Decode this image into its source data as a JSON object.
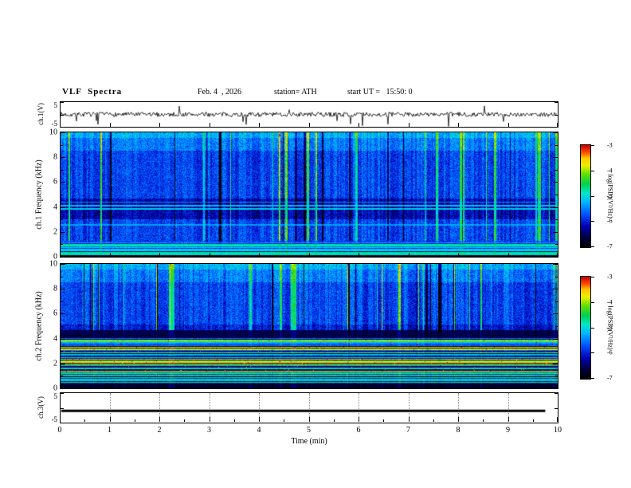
{
  "header": {
    "title": "VLF  Spectra",
    "date": "Feb. 4  , 2026",
    "station": "station= ATH",
    "start_ut": "start UT =   15:50: 0"
  },
  "axes": {
    "x_label": "Time (min)",
    "x_ticks": [
      "0",
      "1",
      "2",
      "3",
      "4",
      "5",
      "6",
      "7",
      "8",
      "9",
      "10"
    ],
    "x_range": [
      0,
      10
    ],
    "freq_ticks": [
      10,
      8,
      6,
      4,
      2,
      0
    ],
    "wave_ticks": [
      5,
      -5
    ]
  },
  "colorbar": {
    "label": "log(PSD)(V²/Hz)",
    "ticks": [
      -3,
      -4,
      -5,
      -6,
      -7
    ],
    "stops": [
      [
        0.0,
        "#000000"
      ],
      [
        0.08,
        "#000035"
      ],
      [
        0.2,
        "#0000b0"
      ],
      [
        0.32,
        "#0050ff"
      ],
      [
        0.44,
        "#00b4ff"
      ],
      [
        0.53,
        "#00e6c8"
      ],
      [
        0.62,
        "#00d050"
      ],
      [
        0.72,
        "#66e000"
      ],
      [
        0.8,
        "#eaf000"
      ],
      [
        0.875,
        "#ffc800"
      ],
      [
        0.93,
        "#ff5000"
      ],
      [
        1.0,
        "#cc0000"
      ]
    ]
  },
  "chart_data": [
    {
      "type": "line",
      "panel": "ch1-waveform",
      "ylabel": "ch.1(V)",
      "x_range": [
        0,
        10
      ],
      "y_range": [
        -5,
        5
      ],
      "seed": 7,
      "signal": {
        "baseline": 0,
        "noise_amp": 0.9,
        "neg_spike_prob": 0.025,
        "pos_spike_prob": 0.01
      },
      "description": "Broadband noise of about ±1 V with many intermittent impulsive downward spikes reaching -5 V across the full 0-10 min record."
    },
    {
      "type": "heatmap",
      "panel": "ch1-spectrogram",
      "ylabel": "ch.1 Frequency (kHz)",
      "x_range": [
        0,
        10
      ],
      "y_range": [
        0,
        10
      ],
      "z_range": [
        -7,
        -3
      ],
      "seed": 21,
      "base_level": 0.3,
      "stripe_min_f": 1.3,
      "stripe": {
        "bright_prob": 0.055,
        "bright_gain": 0.34,
        "dark_prob": 0.06,
        "dark_gain": -0.26
      },
      "bands": [
        {
          "f": [
            9.55,
            10.0
          ],
          "level": 0.14,
          "mode": "add"
        },
        {
          "f": [
            8.5,
            9.55
          ],
          "level": 0.07,
          "mode": "add"
        },
        {
          "f": [
            3.0,
            4.65
          ],
          "level": -0.1,
          "mode": "add"
        },
        {
          "f": [
            3.78,
            3.93
          ],
          "level": 0.48,
          "mode": "set"
        },
        {
          "f": [
            4.03,
            4.14
          ],
          "level": 0.46,
          "mode": "set"
        },
        {
          "f": [
            4.35,
            4.42
          ],
          "level": 0.4,
          "mode": "set"
        },
        {
          "f": [
            2.52,
            2.6
          ],
          "level": 0.42,
          "mode": "set"
        },
        {
          "f": [
            0.0,
            1.15
          ],
          "level": 0.4,
          "mode": "rows"
        },
        {
          "f": [
            0.85,
            1.0
          ],
          "level": 0.55,
          "mode": "set"
        },
        {
          "f": [
            0.0,
            0.1
          ],
          "level": 0.04,
          "mode": "set"
        }
      ],
      "description": "Blue broadband field (PSD ~1e-6) with dense vertical green/cyan impulsive streaks and dark navy streak clusters; darker band 3-4.6 kHz crossed by narrow cyan lines near 3.8 and 4.1 kHz; dense alternating green/dark horizontal striations below ~1.1 kHz."
    },
    {
      "type": "heatmap",
      "panel": "ch2-spectrogram",
      "ylabel": "ch.2 Frequency (kHz)",
      "x_range": [
        0,
        10
      ],
      "y_range": [
        0,
        10
      ],
      "z_range": [
        -7,
        -3
      ],
      "seed": 33,
      "base_level": 0.3,
      "stripe_min_f": 4.7,
      "stripe": {
        "bright_prob": 0.055,
        "bright_gain": 0.34,
        "dark_prob": 0.06,
        "dark_gain": -0.26
      },
      "bands": [
        {
          "f": [
            9.55,
            10.0
          ],
          "level": 0.14,
          "mode": "add"
        },
        {
          "f": [
            8.5,
            9.55
          ],
          "level": 0.07,
          "mode": "add"
        },
        {
          "f": [
            4.7,
            5.1
          ],
          "level": -0.06,
          "mode": "add"
        },
        {
          "f": [
            4.2,
            4.7
          ],
          "level": 0.1,
          "mode": "set"
        },
        {
          "f": [
            3.9,
            4.2
          ],
          "level": 0.3,
          "mode": "rows"
        },
        {
          "f": [
            3.55,
            3.9
          ],
          "level": 0.62,
          "mode": "rows_hot"
        },
        {
          "f": [
            3.35,
            3.55
          ],
          "level": 0.35,
          "mode": "rows"
        },
        {
          "f": [
            2.9,
            3.35
          ],
          "level": 0.62,
          "mode": "rows_hot"
        },
        {
          "f": [
            2.35,
            2.9
          ],
          "level": 0.48,
          "mode": "rows"
        },
        {
          "f": [
            1.35,
            2.35
          ],
          "level": 0.66,
          "mode": "rows_hot"
        },
        {
          "f": [
            0.3,
            1.35
          ],
          "level": 0.5,
          "mode": "rows"
        },
        {
          "f": [
            0.0,
            0.3
          ],
          "level": 0.07,
          "mode": "set"
        }
      ],
      "description": "Upper half (>5 kHz) is a blue field with vertical impulsive streaks like ch.1; below ~4 kHz strong quasi-horizontal banding: bright green/yellow bands near 1.4-2.3, 2.9-3.3 and 3.6-3.9 kHz with sporadic red/orange speckles, separated by darker lanes; dark band 4.2-4.7 kHz; near-black below 0.3 kHz."
    },
    {
      "type": "line",
      "panel": "ch3-waveform",
      "ylabel": "ch.3(V)",
      "x_range": [
        0,
        10
      ],
      "y_range": [
        -5,
        5
      ],
      "seed": 5,
      "x_end": 9.75,
      "signal": {
        "baseline": -1,
        "flat": true,
        "line_width": 3
      },
      "description": "Constant level of about -1 V drawn as a heavy black line ending near 9.75 min (channel flat / no signal)."
    }
  ]
}
